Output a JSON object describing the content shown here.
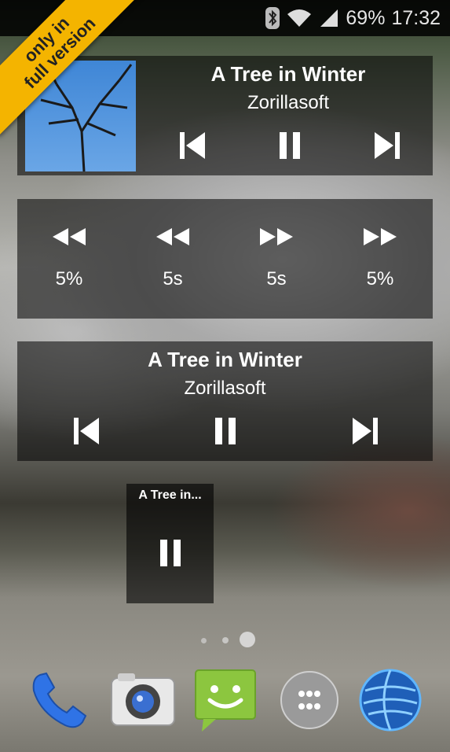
{
  "status": {
    "battery": "69%",
    "time": "17:32"
  },
  "ribbon": {
    "text": "only in\nfull version"
  },
  "widget1": {
    "title": "A Tree in Winter",
    "artist": "Zorillasoft"
  },
  "seek": {
    "labels": [
      "5%",
      "5s",
      "5s",
      "5%"
    ]
  },
  "widget2": {
    "title": "A Tree in Winter",
    "artist": "Zorillasoft"
  },
  "widget3": {
    "title": "A Tree in..."
  },
  "dock": {
    "icons": [
      "phone-icon",
      "camera-icon",
      "messaging-icon",
      "app-drawer-icon",
      "browser-icon"
    ]
  },
  "colors": {
    "ribbon": "#f4b400",
    "phone": "#2f73e6",
    "messaging": "#8cc63f"
  }
}
